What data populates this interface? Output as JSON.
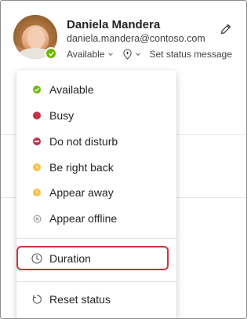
{
  "profile": {
    "name": "Daniela Mandera",
    "email": "daniela.mandera@contoso.com",
    "avatar_icon": "user-photo-avatar",
    "presence_color": "#6bb700",
    "status_label": "Available",
    "location_icon": "location-pin-icon",
    "set_status_label": "Set status message",
    "edit_icon": "pencil-icon"
  },
  "menu": {
    "items": [
      {
        "label": "Available",
        "icon": "available-icon",
        "color": "#6bb700"
      },
      {
        "label": "Busy",
        "icon": "busy-icon",
        "color": "#c4314b"
      },
      {
        "label": "Do not disturb",
        "icon": "do-not-disturb-icon",
        "color": "#c4314b"
      },
      {
        "label": "Be right back",
        "icon": "clock-badge-icon",
        "color": "#f8c146"
      },
      {
        "label": "Appear away",
        "icon": "clock-badge-icon",
        "color": "#f8c146"
      },
      {
        "label": "Appear offline",
        "icon": "offline-icon",
        "color": "#8a8886"
      }
    ],
    "duration_label": "Duration",
    "duration_icon": "clock-icon",
    "reset_label": "Reset status",
    "reset_icon": "reset-icon",
    "highlight_color": "#d13438"
  }
}
